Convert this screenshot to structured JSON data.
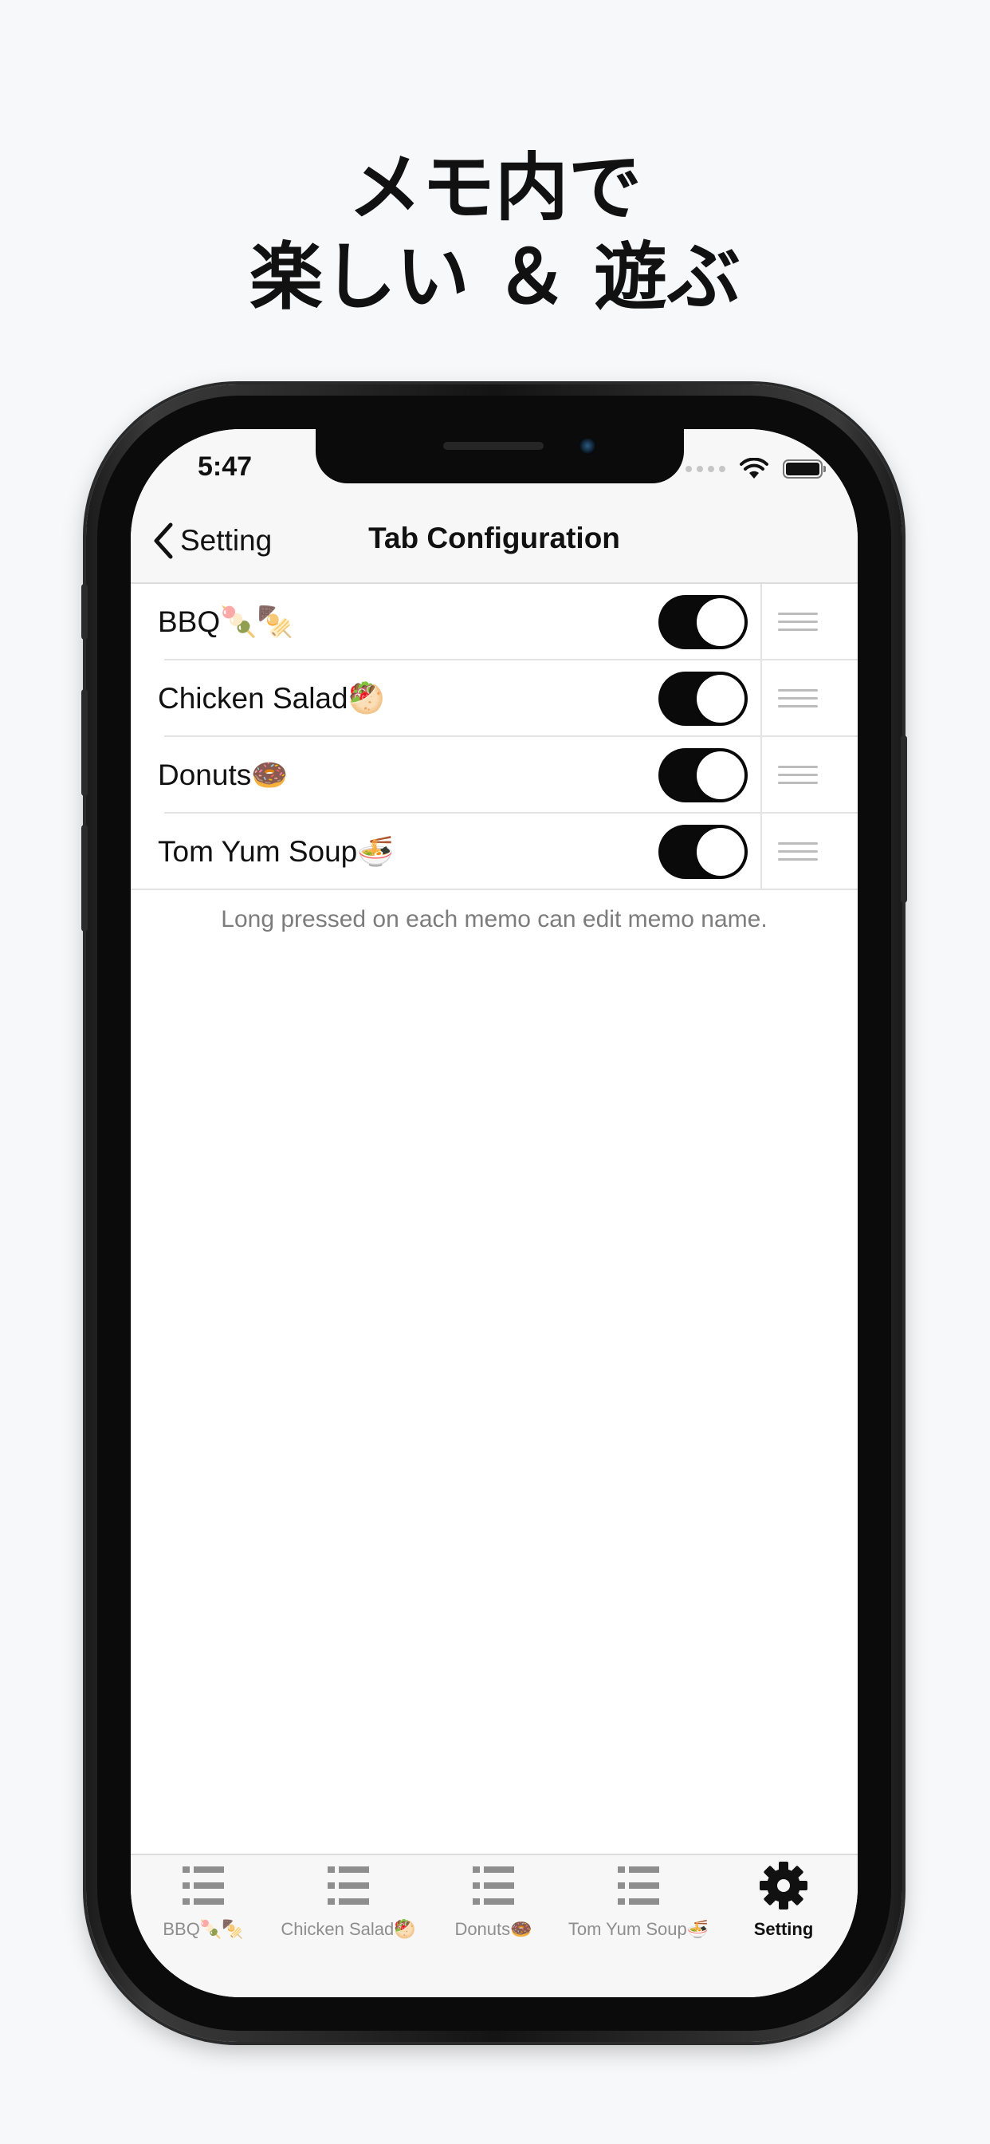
{
  "headline": {
    "line1": "メモ内で",
    "line2": "楽しい ＆ 遊ぶ"
  },
  "status_bar": {
    "time": "5:47"
  },
  "nav": {
    "back_label": "Setting",
    "title": "Tab Configuration"
  },
  "tabs_config": [
    {
      "label": "BBQ🍡🍢",
      "enabled": true
    },
    {
      "label": "Chicken Salad🥙",
      "enabled": true
    },
    {
      "label": "Donuts🍩",
      "enabled": true
    },
    {
      "label": "Tom Yum Soup🍜",
      "enabled": true
    }
  ],
  "footer_note": "Long pressed on each memo can edit memo name.",
  "tab_bar": [
    {
      "label": "BBQ🍡🍢",
      "icon": "list-icon",
      "active": false
    },
    {
      "label": "Chicken Salad🥙",
      "icon": "list-icon",
      "active": false
    },
    {
      "label": "Donuts🍩",
      "icon": "list-icon",
      "active": false
    },
    {
      "label": "Tom Yum Soup🍜",
      "icon": "list-icon",
      "active": false
    },
    {
      "label": "Setting",
      "icon": "gear-icon",
      "active": true
    }
  ],
  "colors": {
    "toggle_on": "#0a0a0a",
    "tab_inactive": "#8e8e8e",
    "tab_active": "#111111",
    "background": "#f7f8fa"
  }
}
